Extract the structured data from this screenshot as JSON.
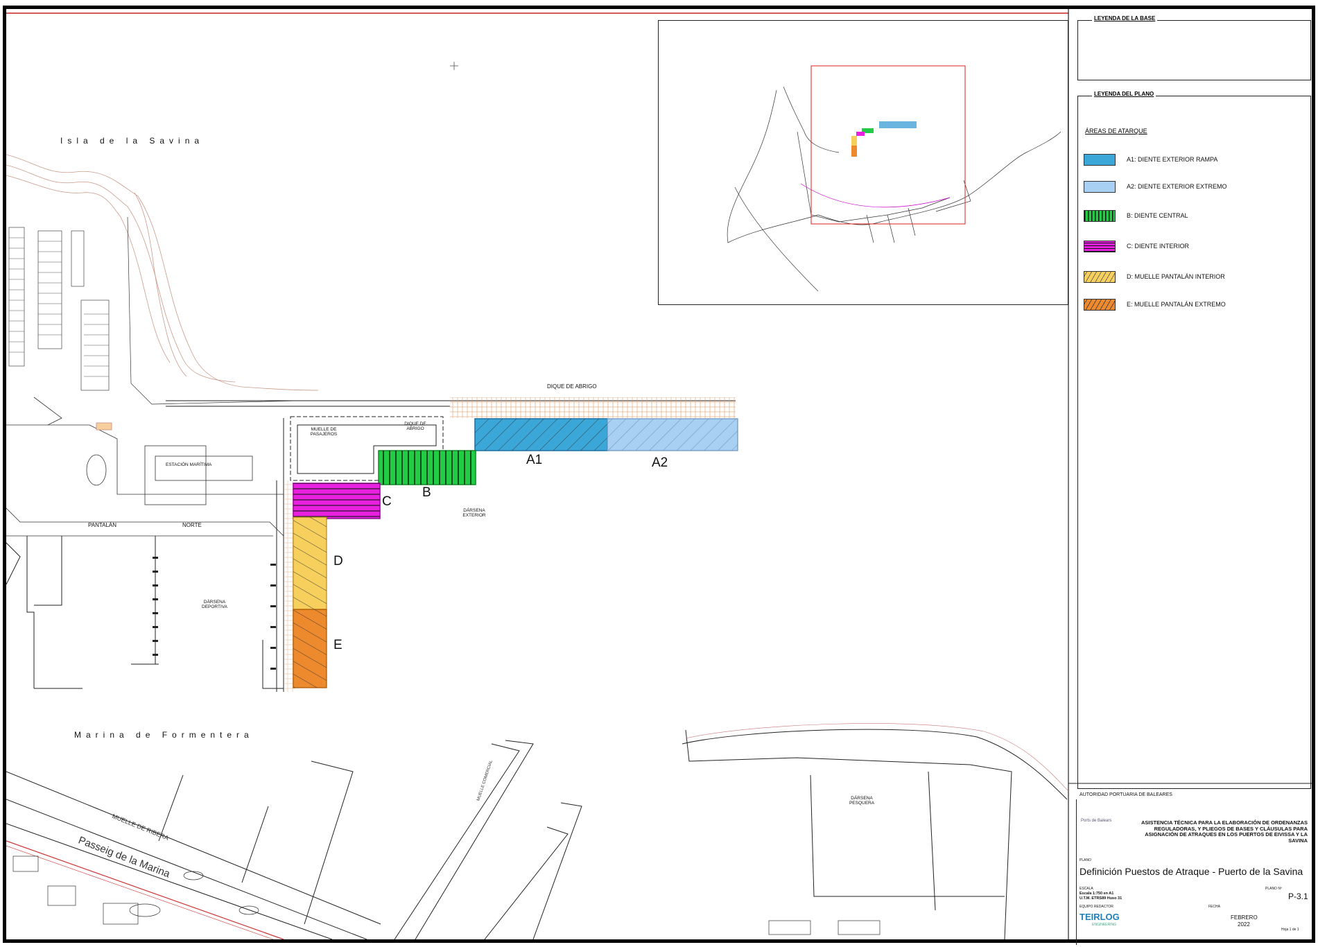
{
  "map": {
    "place_labels": {
      "isla": "Isla de la Savina",
      "marina": "Marina de Formentera"
    },
    "structure_labels": {
      "dique_abrigo": "DIQUE DE ABRIGO",
      "muelle_pasajeros": "MUELLE DE PASAJEROS",
      "dique_de_abrigo_inner": "DIQUE DE ABRIGO",
      "darsena_exterior": "DÁRSENA EXTERIOR",
      "darsena_deportiva": "DÁRSENA DEPORTIVA",
      "pantalan": "PANTALÁN",
      "norte": "NORTE",
      "darsena_pesquera": "DÁRSENA PESQUERA",
      "muelle_ribera": "MUELLE DE RIBERA",
      "paseo": "Passeig de la Marina",
      "muelle_comercial": "MUELLE COMERCIAL",
      "estacion_maritima": "ESTACIÓN MARÍTIMA"
    },
    "zones": [
      {
        "id": "A1",
        "label": "A1",
        "color": "#3aa7d8"
      },
      {
        "id": "A2",
        "label": "A2",
        "color": "#a8d0f2"
      },
      {
        "id": "B",
        "label": "B",
        "color": "#22cc44"
      },
      {
        "id": "C",
        "label": "C",
        "color": "#e820e0"
      },
      {
        "id": "D",
        "label": "D",
        "color": "#f6cf5c"
      },
      {
        "id": "E",
        "label": "E",
        "color": "#ee8a2e"
      }
    ]
  },
  "legend": {
    "base_title": "LEYENDA DE LA BASE",
    "plan_title": "LEYENDA DEL PLANO",
    "areas_title": "ÁREAS DE ATARQUE",
    "items": [
      {
        "label": "A1: DIENTE EXTERIOR RAMPA",
        "color": "#3aa7d8",
        "hatch": "diag"
      },
      {
        "label": "A2: DIENTE EXTERIOR EXTREMO",
        "color": "#a8d0f2",
        "hatch": "diag"
      },
      {
        "label": "B: DIENTE CENTRAL",
        "color": "#22cc44",
        "hatch": "vert"
      },
      {
        "label": "C: DIENTE INTERIOR",
        "color": "#e820e0",
        "hatch": "horiz"
      },
      {
        "label": "D: MUELLE PANTALÁN INTERIOR",
        "color": "#f6cf5c",
        "hatch": "diag"
      },
      {
        "label": "E: MUELLE PANTALÁN EXTREMO",
        "color": "#ee8a2e",
        "hatch": "diag"
      }
    ]
  },
  "titleblock": {
    "authority": "AUTORIDAD PORTUARIA DE BALEARES",
    "project": "ASISTENCIA TÉCNICA PARA LA ELABORACIÓN DE ORDENANZAS REGULADORAS, Y PLIEGOS DE BASES Y CLÁUSULAS PARA ASIGNACIÓN DE ATRAQUES EN LOS PUERTOS DE EIVISSA Y LA SAVINA",
    "logo_text": "Ports de Balears",
    "plano_label": "PLANO",
    "plan_title": "Definición Puestos de Atraque - Puerto de la Savina",
    "escala_label": "ESCALA",
    "escala_value": "Escala 1:750 en A1",
    "utm": "U.T.M. ETRS89 Huso 31",
    "plano_num_label": "PLANO Nº",
    "plano_num": "P-3.1",
    "equipo_label": "EQUIPO REDACTOR",
    "company": "TEIRLOG",
    "company_sub": "ENGINEERING",
    "fecha_label": "FECHA",
    "fecha_month": "FEBRERO",
    "fecha_year": "2022",
    "hoja": "Hoja 1 de 1"
  }
}
